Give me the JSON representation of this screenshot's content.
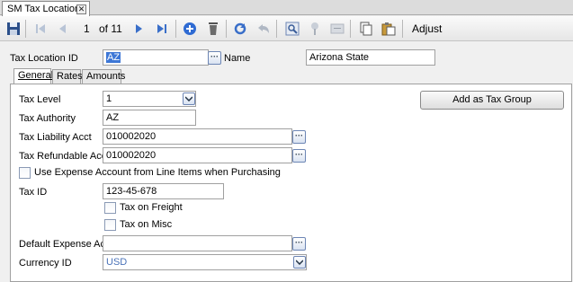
{
  "window": {
    "tab_title": "SM Tax Locations"
  },
  "toolbar": {
    "record_position": "1",
    "record_total": "of 11",
    "adjust_label": "Adjust"
  },
  "header": {
    "tax_location_label": "Tax Location ID",
    "tax_location_value": "AZ",
    "name_label": "Name",
    "name_value": "Arizona State"
  },
  "tabs": [
    {
      "label": "General",
      "active": true
    },
    {
      "label": "Rates",
      "active": false
    },
    {
      "label": "Amounts",
      "active": false
    }
  ],
  "general": {
    "tax_level_label": "Tax Level",
    "tax_level_value": "1",
    "tax_authority_label": "Tax Authority",
    "tax_authority_value": "AZ",
    "tax_liability_label": "Tax Liability Acct",
    "tax_liability_value": "010002020",
    "tax_refundable_label": "Tax Refundable Acct",
    "tax_refundable_value": "010002020",
    "use_expense_label": "Use Expense Account from Line Items when Purchasing",
    "tax_id_label": "Tax ID",
    "tax_id_value": "123-45-678",
    "tax_on_freight_label": "Tax on Freight",
    "tax_on_misc_label": "Tax on Misc",
    "default_expense_label": "Default Expense Acct",
    "default_expense_value": "",
    "currency_label": "Currency ID",
    "currency_value": "USD",
    "add_group_button": "Add as Tax Group"
  }
}
